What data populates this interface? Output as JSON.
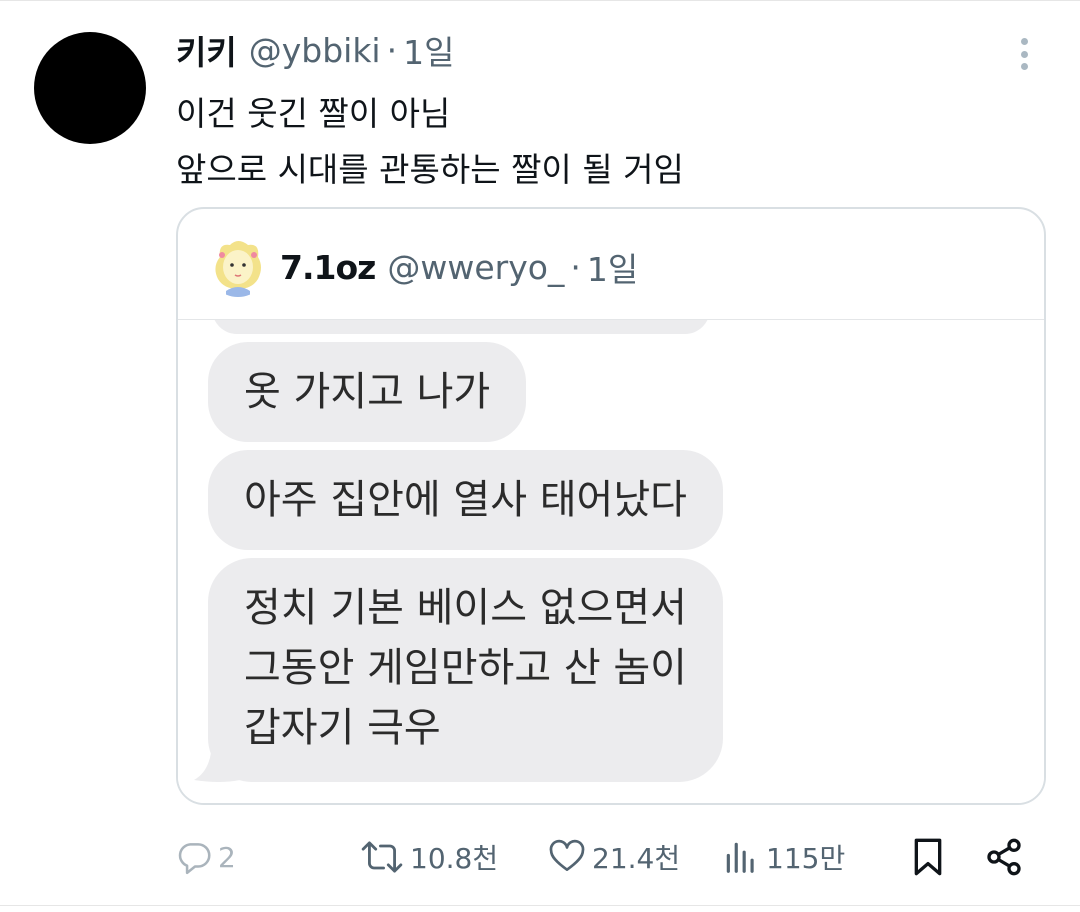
{
  "tweet": {
    "display_name": "키키",
    "handle": "@ybbiki",
    "separator": "·",
    "time": "1일",
    "text_lines": [
      "이건 웃긴 짤이 아님",
      "앞으로 시대를 관통하는 짤이 될 거임"
    ]
  },
  "quote": {
    "display_name": "7.1oz",
    "handle": "@wweryo_",
    "separator": "·",
    "time": "1일",
    "messages": [
      {
        "lines": [
          "옷 가지고 나가"
        ]
      },
      {
        "lines": [
          "아주 집안에 열사 태어났다"
        ]
      },
      {
        "lines": [
          "정치 기본 베이스 없으면서",
          "그동안 게임만하고 산 놈이",
          "갑자기 극우"
        ]
      }
    ]
  },
  "actions": {
    "reply": {
      "icon": "reply-icon",
      "count": "2"
    },
    "retweet": {
      "icon": "retweet-icon",
      "count": "10.8천"
    },
    "like": {
      "icon": "heart-icon",
      "count": "21.4천"
    },
    "views": {
      "icon": "views-icon",
      "count": "115만"
    },
    "bookmark": {
      "icon": "bookmark-icon"
    },
    "share": {
      "icon": "share-icon"
    }
  },
  "colors": {
    "text": "#0f1419",
    "secondary": "#536471",
    "border": "#d9dfe3",
    "bubble": "#ececee"
  }
}
